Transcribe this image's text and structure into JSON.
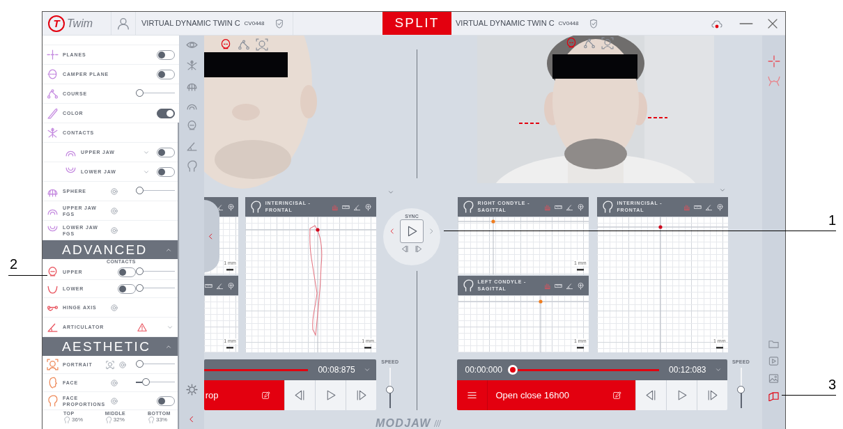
{
  "title_bar": {
    "logo": {
      "mark": "T",
      "name": "Twim"
    },
    "left_title": {
      "name": "VIRTUAL DYNAMIC TWIN C",
      "code": "CV0448"
    },
    "split": "SPLIT",
    "right_title": {
      "name": "VIRTUAL DYNAMIC TWIN C",
      "code": "CV0448"
    }
  },
  "sidebar": {
    "items": [
      {
        "label": "PLANES",
        "on": false
      },
      {
        "label": "CAMPER PLANE",
        "on": false
      },
      {
        "label": "COURSE",
        "level": 0
      },
      {
        "label": "COLOR",
        "on": true
      },
      {
        "label": "CONTACTS",
        "children": [
          {
            "label": "UPPER JAW",
            "dropdown": true,
            "on": false
          },
          {
            "label": "LOWER JAW",
            "dropdown": true,
            "on": false
          }
        ]
      },
      {
        "label": "SPHERE",
        "target": true,
        "level": 0
      },
      {
        "label": "UPPER JAW FGS",
        "target": true
      },
      {
        "label": "LOWER JAW FGS",
        "target": true
      }
    ],
    "sections": [
      {
        "title": "ADVANCED",
        "expanded": true,
        "caption": "CONTACTS",
        "items": [
          {
            "label": "UPPER",
            "on": false,
            "level": 0
          },
          {
            "label": "LOWER",
            "on": false,
            "level": 0
          },
          {
            "label": "HINGE AXIS",
            "target": true
          },
          {
            "label": "ARTICULATOR",
            "warning": true,
            "dropdown": true
          }
        ]
      },
      {
        "title": "AESTHETIC",
        "expanded": true,
        "items": [
          {
            "label": "PORTRAIT",
            "expand": true,
            "target": true,
            "level": 0
          },
          {
            "label": "FACE",
            "target": true,
            "level": 0.2
          },
          {
            "label": "FACE PROPORTIONS",
            "target": true,
            "on": false
          }
        ],
        "proportions": [
          {
            "label": "TOP",
            "value": "36%"
          },
          {
            "label": "MIDDLE",
            "value": "32%"
          },
          {
            "label": "BOTTOM",
            "value": "33%"
          }
        ]
      }
    ]
  },
  "left_view": {
    "view_modes": [
      {
        "selected": true
      },
      {
        "selected": false
      },
      {
        "selected": false
      }
    ],
    "graphs": [
      {
        "scale": "1 mm"
      },
      {
        "scale": "1 mm"
      },
      {
        "title": "INTERINCISAL - FRONTAL",
        "scale": "1 mm",
        "color": "#d0021b"
      }
    ],
    "playback": {
      "end_time": "00:08:875",
      "recording": "rop"
    },
    "speed": {
      "label": "SPEED",
      "level": 0.45
    }
  },
  "sync": {
    "label": "SYNC"
  },
  "right_view": {
    "view_modes": [
      {
        "selected": true
      },
      {
        "selected": false
      },
      {
        "selected": false
      }
    ],
    "graphs": [
      {
        "title": "RIGHT CONDYLE - SAGITTAL",
        "scale": "1 mm",
        "color": "#f07d1e"
      },
      {
        "title": "LEFT CONDYLE - SAGITTAL",
        "scale": "1 mm",
        "color": "#f07d1e"
      },
      {
        "title": "INTERINCISAL - FRONTAL",
        "scale": "1 mm",
        "color": "#d0021b"
      }
    ],
    "playback": {
      "start_time": "00:00:000",
      "end_time": "00:12:083",
      "level": 0,
      "recording": "Open close 16h00",
      "menu": true
    },
    "speed": {
      "label": "SPEED",
      "level": 0.45
    }
  },
  "brand": "MODJAW",
  "callouts": [
    {
      "label": "1"
    },
    {
      "label": "2"
    },
    {
      "label": "3"
    }
  ]
}
